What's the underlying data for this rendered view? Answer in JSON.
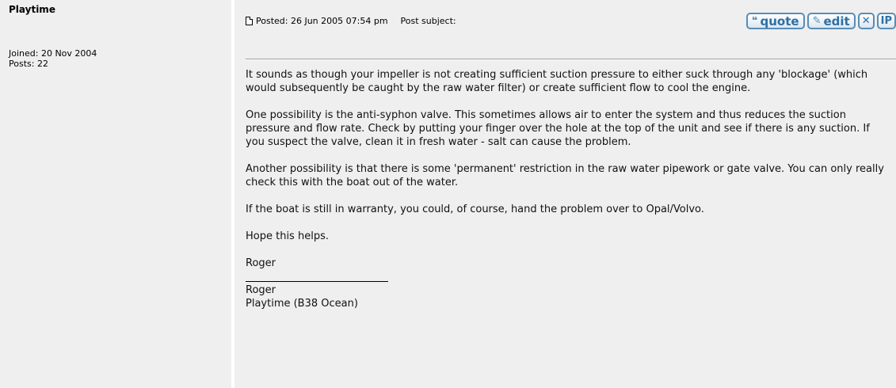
{
  "author": {
    "name": "Playtime",
    "joined": "Joined: 20 Nov 2004",
    "posts": "Posts: 22"
  },
  "post": {
    "posted": "Posted: 26 Jun 2005 07:54 pm",
    "subject_label": "Post subject:",
    "buttons": {
      "quote": "quote",
      "edit": "edit",
      "delete": "✕",
      "ip": "IP"
    },
    "paragraphs": [
      "It sounds as though your impeller is not creating sufficient suction pressure to either suck through any 'blockage' (which would subsequently be caught by the raw water filter) or create sufficient flow to cool the engine.",
      "One possibility is the anti-syphon valve. This sometimes allows air to enter the system and thus reduces the suction pressure and flow rate. Check by putting your finger over the hole at the top of the unit and see if there is any suction. If you suspect the valve, clean it in fresh water - salt can cause the problem.",
      "Another possibility is that there is some 'permanent' restriction in the raw water pipework or gate valve. You can only really check this with the boat out of the water.",
      "If the boat is still in warranty, you could, of course, hand the problem over to Opal/Volvo.",
      "Hope this helps.",
      "Roger"
    ],
    "signature": {
      "line1": "Roger",
      "line2": "Playtime (B38 Ocean)"
    }
  },
  "colors": {
    "panel": "#efefef",
    "button_border": "#5a8db3",
    "button_text": "#2f6fa3"
  },
  "icons": {
    "post": "document-icon",
    "quote": "quote-icon",
    "edit": "edit-icon",
    "delete": "delete-icon"
  }
}
